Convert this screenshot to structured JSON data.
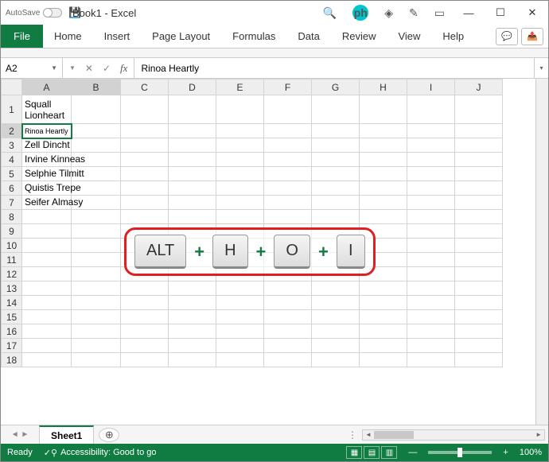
{
  "title": "Book1 - Excel",
  "autosave": {
    "label": "AutoSave",
    "state": "Off"
  },
  "tabs": [
    "Home",
    "Insert",
    "Page Layout",
    "Formulas",
    "Data",
    "Review",
    "View",
    "Help"
  ],
  "file_tab": "File",
  "name_box": "A2",
  "formula_value": "Rinoa Heartly",
  "columns": [
    "A",
    "B",
    "C",
    "D",
    "E",
    "F",
    "G",
    "H",
    "I",
    "J"
  ],
  "selected_cell": {
    "row": 2,
    "col": "A"
  },
  "editing_text": "Rinoa Heartly",
  "cells": {
    "1": {
      "A": "Squall Lionheart",
      "wrap": true
    },
    "2": {
      "A": "Rinoa Heartly"
    },
    "3": {
      "A": "Zell Dincht"
    },
    "4": {
      "A": "Irvine Kinneas"
    },
    "5": {
      "A": "Selphie Tilmitt"
    },
    "6": {
      "A": "Quistis Trepe"
    },
    "7": {
      "A": "Seifer Almasy"
    }
  },
  "row_count": 18,
  "keys": [
    "ALT",
    "H",
    "O",
    "I"
  ],
  "sheet_name": "Sheet1",
  "status": {
    "mode": "Ready",
    "accessibility": "Accessibility: Good to go",
    "zoom": "100%"
  }
}
